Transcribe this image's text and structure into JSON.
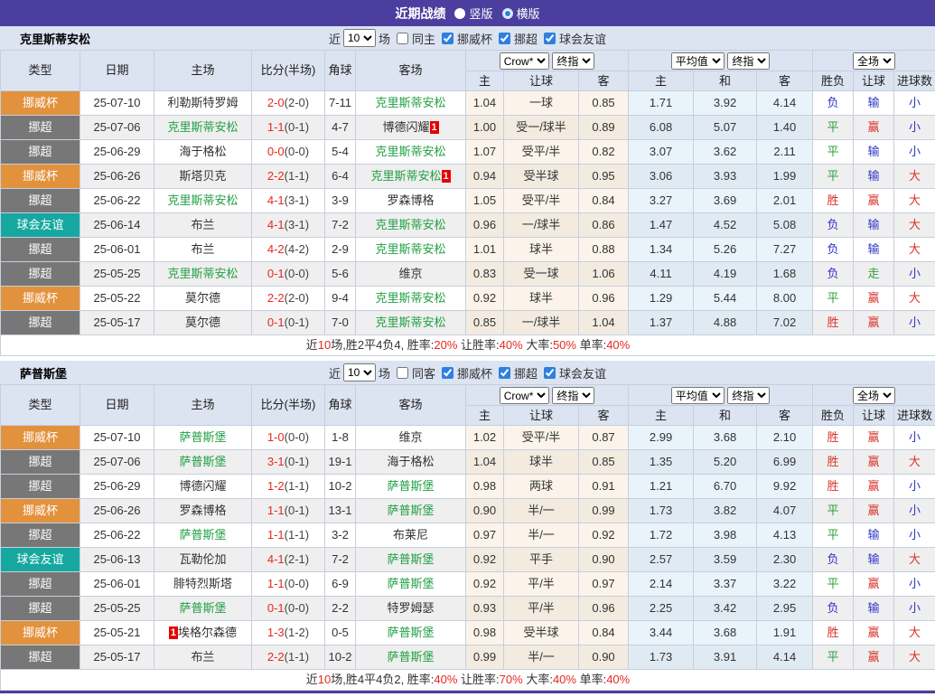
{
  "title_bar": {
    "title": "近期战绩",
    "options": [
      {
        "label": "竖版",
        "selected": false
      },
      {
        "label": "横版",
        "selected": true
      }
    ]
  },
  "colors": {
    "header_purple": "#4b3e9e",
    "badge_cup_orange": "#e2913c",
    "badge_league_gray": "#777777",
    "badge_friendly_teal": "#16a8a0",
    "team_highlight_green": "#22a045",
    "score_red": "#e8281e",
    "result_red": "#d9342b",
    "result_green": "#2e9e3e",
    "result_blue": "#3333cc",
    "crow_column_bg": "#fcf4ea",
    "avg_column_bg": "#e9f3fa"
  },
  "table_header": {
    "cols": [
      "类型",
      "日期",
      "主场",
      "比分(半场)",
      "角球",
      "客场"
    ],
    "selects": {
      "company": "Crow*",
      "final1": "终指",
      "avg": "平均值",
      "final2": "终指",
      "scope": "全场"
    },
    "sub": [
      "主",
      "让球",
      "客",
      "主",
      "和",
      "客",
      "胜负",
      "让球",
      "进球数"
    ]
  },
  "sections": [
    {
      "team": "克里斯蒂安松",
      "filter": {
        "near": "近",
        "count": "10",
        "games": "场",
        "same": {
          "label": "同主",
          "checked": false
        },
        "leagues": [
          {
            "label": "挪威杯",
            "checked": true
          },
          {
            "label": "挪超",
            "checked": true
          },
          {
            "label": "球会友谊",
            "checked": true
          }
        ]
      },
      "rows": [
        {
          "type": "挪威杯",
          "tone": "cup",
          "date": "25-07-10",
          "home": {
            "t": "利勒斯特罗姆"
          },
          "score": {
            "ft": "2-0",
            "ht": "(2-0)"
          },
          "corner": "7-11",
          "away": {
            "t": "克里斯蒂安松",
            "hl": true
          },
          "crow": [
            "1.04",
            "一球",
            "0.85"
          ],
          "avg": [
            "1.71",
            "3.92",
            "4.14"
          ],
          "res": [
            [
              "负",
              "b"
            ],
            [
              "输",
              "b"
            ],
            [
              "小",
              "b"
            ]
          ]
        },
        {
          "type": "挪超",
          "tone": "league",
          "date": "25-07-06",
          "home": {
            "t": "克里斯蒂安松",
            "hl": true
          },
          "score": {
            "ft": "1-1",
            "ht": "(0-1)"
          },
          "corner": "4-7",
          "away": {
            "t": "博德闪耀",
            "card": {
              "pos": "after",
              "t": "1"
            }
          },
          "crow": [
            "1.00",
            "受一/球半",
            "0.89"
          ],
          "avg": [
            "6.08",
            "5.07",
            "1.40"
          ],
          "res": [
            [
              "平",
              "g"
            ],
            [
              "赢",
              "r"
            ],
            [
              "小",
              "b"
            ]
          ]
        },
        {
          "type": "挪超",
          "tone": "league",
          "date": "25-06-29",
          "home": {
            "t": "海于格松"
          },
          "score": {
            "ft": "0-0",
            "ht": "(0-0)"
          },
          "corner": "5-4",
          "away": {
            "t": "克里斯蒂安松",
            "hl": true
          },
          "crow": [
            "1.07",
            "受平/半",
            "0.82"
          ],
          "avg": [
            "3.07",
            "3.62",
            "2.11"
          ],
          "res": [
            [
              "平",
              "g"
            ],
            [
              "输",
              "b"
            ],
            [
              "小",
              "b"
            ]
          ]
        },
        {
          "type": "挪威杯",
          "tone": "cup",
          "date": "25-06-26",
          "home": {
            "t": "斯塔贝克"
          },
          "score": {
            "ft": "2-2",
            "ht": "(1-1)"
          },
          "corner": "6-4",
          "away": {
            "t": "克里斯蒂安松",
            "hl": true,
            "card": {
              "pos": "after",
              "t": "1"
            }
          },
          "crow": [
            "0.94",
            "受半球",
            "0.95"
          ],
          "avg": [
            "3.06",
            "3.93",
            "1.99"
          ],
          "res": [
            [
              "平",
              "g"
            ],
            [
              "输",
              "b"
            ],
            [
              "大",
              "r"
            ]
          ]
        },
        {
          "type": "挪超",
          "tone": "league",
          "date": "25-06-22",
          "home": {
            "t": "克里斯蒂安松",
            "hl": true
          },
          "score": {
            "ft": "4-1",
            "ht": "(3-1)"
          },
          "corner": "3-9",
          "away": {
            "t": "罗森博格"
          },
          "crow": [
            "1.05",
            "受平/半",
            "0.84"
          ],
          "avg": [
            "3.27",
            "3.69",
            "2.01"
          ],
          "res": [
            [
              "胜",
              "r"
            ],
            [
              "赢",
              "r"
            ],
            [
              "大",
              "r"
            ]
          ]
        },
        {
          "type": "球会友谊",
          "tone": "friendly",
          "date": "25-06-14",
          "home": {
            "t": "布兰"
          },
          "score": {
            "ft": "4-1",
            "ht": "(3-1)"
          },
          "corner": "7-2",
          "away": {
            "t": "克里斯蒂安松",
            "hl": true
          },
          "crow": [
            "0.96",
            "一/球半",
            "0.86"
          ],
          "avg": [
            "1.47",
            "4.52",
            "5.08"
          ],
          "res": [
            [
              "负",
              "b"
            ],
            [
              "输",
              "b"
            ],
            [
              "大",
              "r"
            ]
          ]
        },
        {
          "type": "挪超",
          "tone": "league",
          "date": "25-06-01",
          "home": {
            "t": "布兰"
          },
          "score": {
            "ft": "4-2",
            "ht": "(4-2)"
          },
          "corner": "2-9",
          "away": {
            "t": "克里斯蒂安松",
            "hl": true
          },
          "crow": [
            "1.01",
            "球半",
            "0.88"
          ],
          "avg": [
            "1.34",
            "5.26",
            "7.27"
          ],
          "res": [
            [
              "负",
              "b"
            ],
            [
              "输",
              "b"
            ],
            [
              "大",
              "r"
            ]
          ]
        },
        {
          "type": "挪超",
          "tone": "league",
          "date": "25-05-25",
          "home": {
            "t": "克里斯蒂安松",
            "hl": true
          },
          "score": {
            "ft": "0-1",
            "ht": "(0-0)"
          },
          "corner": "5-6",
          "away": {
            "t": "维京"
          },
          "crow": [
            "0.83",
            "受一球",
            "1.06"
          ],
          "avg": [
            "4.11",
            "4.19",
            "1.68"
          ],
          "res": [
            [
              "负",
              "b"
            ],
            [
              "走",
              "g"
            ],
            [
              "小",
              "b"
            ]
          ]
        },
        {
          "type": "挪威杯",
          "tone": "cup",
          "date": "25-05-22",
          "home": {
            "t": "莫尔德"
          },
          "score": {
            "ft": "2-2",
            "ht": "(2-0)"
          },
          "corner": "9-4",
          "away": {
            "t": "克里斯蒂安松",
            "hl": true
          },
          "crow": [
            "0.92",
            "球半",
            "0.96"
          ],
          "avg": [
            "1.29",
            "5.44",
            "8.00"
          ],
          "res": [
            [
              "平",
              "g"
            ],
            [
              "赢",
              "r"
            ],
            [
              "大",
              "r"
            ]
          ]
        },
        {
          "type": "挪超",
          "tone": "league",
          "date": "25-05-17",
          "home": {
            "t": "莫尔德"
          },
          "score": {
            "ft": "0-1",
            "ht": "(0-1)"
          },
          "corner": "7-0",
          "away": {
            "t": "克里斯蒂安松",
            "hl": true
          },
          "crow": [
            "0.85",
            "一/球半",
            "1.04"
          ],
          "avg": [
            "1.37",
            "4.88",
            "7.02"
          ],
          "res": [
            [
              "胜",
              "r"
            ],
            [
              "赢",
              "r"
            ],
            [
              "小",
              "b"
            ]
          ]
        }
      ],
      "summary": [
        [
          "近",
          "k"
        ],
        [
          "10",
          "r"
        ],
        [
          "场,胜2平4负4, 胜率:",
          "k"
        ],
        [
          "20%",
          "r"
        ],
        [
          " 让胜率:",
          "k"
        ],
        [
          "40%",
          "r"
        ],
        [
          " 大率:",
          "k"
        ],
        [
          "50%",
          "r"
        ],
        [
          " 单率:",
          "k"
        ],
        [
          "40%",
          "r"
        ]
      ]
    },
    {
      "team": "萨普斯堡",
      "filter": {
        "near": "近",
        "count": "10",
        "games": "场",
        "same": {
          "label": "同客",
          "checked": false
        },
        "leagues": [
          {
            "label": "挪威杯",
            "checked": true
          },
          {
            "label": "挪超",
            "checked": true
          },
          {
            "label": "球会友谊",
            "checked": true
          }
        ]
      },
      "rows": [
        {
          "type": "挪威杯",
          "tone": "cup",
          "date": "25-07-10",
          "home": {
            "t": "萨普斯堡",
            "hl": true
          },
          "score": {
            "ft": "1-0",
            "ht": "(0-0)"
          },
          "corner": "1-8",
          "away": {
            "t": "维京"
          },
          "crow": [
            "1.02",
            "受平/半",
            "0.87"
          ],
          "avg": [
            "2.99",
            "3.68",
            "2.10"
          ],
          "res": [
            [
              "胜",
              "r"
            ],
            [
              "赢",
              "r"
            ],
            [
              "小",
              "b"
            ]
          ]
        },
        {
          "type": "挪超",
          "tone": "league",
          "date": "25-07-06",
          "home": {
            "t": "萨普斯堡",
            "hl": true
          },
          "score": {
            "ft": "3-1",
            "ht": "(0-1)"
          },
          "corner": "19-1",
          "away": {
            "t": "海于格松"
          },
          "crow": [
            "1.04",
            "球半",
            "0.85"
          ],
          "avg": [
            "1.35",
            "5.20",
            "6.99"
          ],
          "res": [
            [
              "胜",
              "r"
            ],
            [
              "赢",
              "r"
            ],
            [
              "大",
              "r"
            ]
          ]
        },
        {
          "type": "挪超",
          "tone": "league",
          "date": "25-06-29",
          "home": {
            "t": "博德闪耀"
          },
          "score": {
            "ft": "1-2",
            "ht": "(1-1)"
          },
          "corner": "10-2",
          "away": {
            "t": "萨普斯堡",
            "hl": true
          },
          "crow": [
            "0.98",
            "两球",
            "0.91"
          ],
          "avg": [
            "1.21",
            "6.70",
            "9.92"
          ],
          "res": [
            [
              "胜",
              "r"
            ],
            [
              "赢",
              "r"
            ],
            [
              "小",
              "b"
            ]
          ]
        },
        {
          "type": "挪威杯",
          "tone": "cup",
          "date": "25-06-26",
          "home": {
            "t": "罗森博格"
          },
          "score": {
            "ft": "1-1",
            "ht": "(0-1)"
          },
          "corner": "13-1",
          "away": {
            "t": "萨普斯堡",
            "hl": true
          },
          "crow": [
            "0.90",
            "半/一",
            "0.99"
          ],
          "avg": [
            "1.73",
            "3.82",
            "4.07"
          ],
          "res": [
            [
              "平",
              "g"
            ],
            [
              "赢",
              "r"
            ],
            [
              "小",
              "b"
            ]
          ]
        },
        {
          "type": "挪超",
          "tone": "league",
          "date": "25-06-22",
          "home": {
            "t": "萨普斯堡",
            "hl": true
          },
          "score": {
            "ft": "1-1",
            "ht": "(1-1)"
          },
          "corner": "3-2",
          "away": {
            "t": "布莱尼"
          },
          "crow": [
            "0.97",
            "半/一",
            "0.92"
          ],
          "avg": [
            "1.72",
            "3.98",
            "4.13"
          ],
          "res": [
            [
              "平",
              "g"
            ],
            [
              "输",
              "b"
            ],
            [
              "小",
              "b"
            ]
          ]
        },
        {
          "type": "球会友谊",
          "tone": "friendly",
          "date": "25-06-13",
          "home": {
            "t": "瓦勒伦加"
          },
          "score": {
            "ft": "4-1",
            "ht": "(2-1)"
          },
          "corner": "7-2",
          "away": {
            "t": "萨普斯堡",
            "hl": true
          },
          "crow": [
            "0.92",
            "平手",
            "0.90"
          ],
          "avg": [
            "2.57",
            "3.59",
            "2.30"
          ],
          "res": [
            [
              "负",
              "b"
            ],
            [
              "输",
              "b"
            ],
            [
              "大",
              "r"
            ]
          ]
        },
        {
          "type": "挪超",
          "tone": "league",
          "date": "25-06-01",
          "home": {
            "t": "腓特烈斯塔"
          },
          "score": {
            "ft": "1-1",
            "ht": "(0-0)"
          },
          "corner": "6-9",
          "away": {
            "t": "萨普斯堡",
            "hl": true
          },
          "crow": [
            "0.92",
            "平/半",
            "0.97"
          ],
          "avg": [
            "2.14",
            "3.37",
            "3.22"
          ],
          "res": [
            [
              "平",
              "g"
            ],
            [
              "赢",
              "r"
            ],
            [
              "小",
              "b"
            ]
          ]
        },
        {
          "type": "挪超",
          "tone": "league",
          "date": "25-05-25",
          "home": {
            "t": "萨普斯堡",
            "hl": true
          },
          "score": {
            "ft": "0-1",
            "ht": "(0-0)"
          },
          "corner": "2-2",
          "away": {
            "t": "特罗姆瑟"
          },
          "crow": [
            "0.93",
            "平/半",
            "0.96"
          ],
          "avg": [
            "2.25",
            "3.42",
            "2.95"
          ],
          "res": [
            [
              "负",
              "b"
            ],
            [
              "输",
              "b"
            ],
            [
              "小",
              "b"
            ]
          ]
        },
        {
          "type": "挪威杯",
          "tone": "cup",
          "date": "25-05-21",
          "home": {
            "t": "埃格尔森德",
            "card": {
              "pos": "before",
              "t": "1"
            }
          },
          "score": {
            "ft": "1-3",
            "ht": "(1-2)"
          },
          "corner": "0-5",
          "away": {
            "t": "萨普斯堡",
            "hl": true
          },
          "crow": [
            "0.98",
            "受半球",
            "0.84"
          ],
          "avg": [
            "3.44",
            "3.68",
            "1.91"
          ],
          "res": [
            [
              "胜",
              "r"
            ],
            [
              "赢",
              "r"
            ],
            [
              "大",
              "r"
            ]
          ]
        },
        {
          "type": "挪超",
          "tone": "league",
          "date": "25-05-17",
          "home": {
            "t": "布兰"
          },
          "score": {
            "ft": "2-2",
            "ht": "(1-1)"
          },
          "corner": "10-2",
          "away": {
            "t": "萨普斯堡",
            "hl": true
          },
          "crow": [
            "0.99",
            "半/一",
            "0.90"
          ],
          "avg": [
            "1.73",
            "3.91",
            "4.14"
          ],
          "res": [
            [
              "平",
              "g"
            ],
            [
              "赢",
              "r"
            ],
            [
              "大",
              "r"
            ]
          ]
        }
      ],
      "summary": [
        [
          "近",
          "k"
        ],
        [
          "10",
          "r"
        ],
        [
          "场,胜4平4负2, 胜率:",
          "k"
        ],
        [
          "40%",
          "r"
        ],
        [
          " 让胜率:",
          "k"
        ],
        [
          "70%",
          "r"
        ],
        [
          " 大率:",
          "k"
        ],
        [
          "40%",
          "r"
        ],
        [
          " 单率:",
          "k"
        ],
        [
          "40%",
          "r"
        ]
      ]
    }
  ]
}
